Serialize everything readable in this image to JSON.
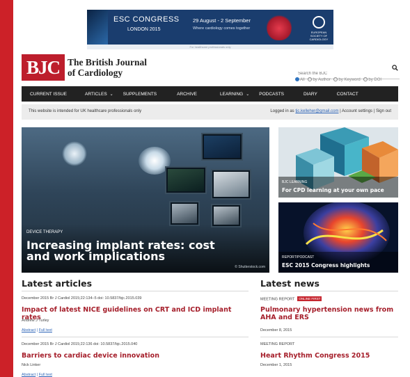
{
  "ad": {
    "congress": "ESC CONGRESS",
    "city": "LONDON  2015",
    "dates": "29 August - 2 September",
    "tagline": "Where cardiology comes together",
    "society": "EUROPEAN SOCIETY OF CARDIOLOGY",
    "note": "For healthcare professionals only"
  },
  "header": {
    "logo": "BJC",
    "brand_line1": "The British Journal",
    "brand_line2": "of Cardiology"
  },
  "search": {
    "placeholder": "Search the BJC",
    "options": [
      "All",
      "by Author",
      "by Keyword",
      "by DOI"
    ],
    "selected": "All"
  },
  "nav": {
    "items": [
      "CURRENT ISSUE",
      "ARTICLES",
      "SUPPLEMENTS",
      "ARCHIVE",
      "LEARNING",
      "PODCASTS",
      "DIARY",
      "CONTACT"
    ]
  },
  "subbar": {
    "notice": "This website is intended for UK healthcare professionals only",
    "logged_prefix": "Logged in as",
    "email": "tjc.kelleher@gmail.com",
    "account": "Account settings",
    "signout": "Sign out"
  },
  "hero": {
    "kicker": "DEVICE THERAPY",
    "title": "Increasing implant rates: cost and work implications",
    "credit": "© Shutterstock.com"
  },
  "tiles": [
    {
      "kicker": "BJC LEARNING",
      "title": "For CPD learning at your own pace"
    },
    {
      "kicker": "REPORT/PODCAST",
      "title": "ESC 2015 Congress highlights"
    }
  ],
  "latest_articles": {
    "heading": "Latest articles",
    "items": [
      {
        "meta": "December 2015   Br J Cardiol 2015;22:134–5   doi: 10.5837/bjc.2015.039",
        "title": "Impact of latest NICE guidelines on CRT and ICD implant rates",
        "author": "Andrew J Turley",
        "abstract": "Abstract",
        "fulltext": "Full text"
      },
      {
        "meta": "December 2015   Br J Cardiol 2015;22:136   doi: 10.5837/bjc.2015.040",
        "title": "Barriers to cardiac device innovation",
        "author": "Nick Linker",
        "abstract": "Abstract",
        "fulltext": "Full text"
      }
    ]
  },
  "latest_news": {
    "heading": "Latest news",
    "items": [
      {
        "type": "MEETING REPORT",
        "badge": "ONLINE FIRST",
        "title": "Pulmonary hypertension news from AHA and ERS",
        "date": "December 8, 2015"
      },
      {
        "type": "MEETING REPORT",
        "badge": "",
        "title": "Heart Rhythm Congress 2015",
        "date": "December 1, 2015"
      }
    ]
  },
  "colors": {
    "brand_red": "#bd1e2c",
    "headline_red": "#a51e2a",
    "nav_bg": "#222222",
    "link_blue": "#2d64b7"
  }
}
